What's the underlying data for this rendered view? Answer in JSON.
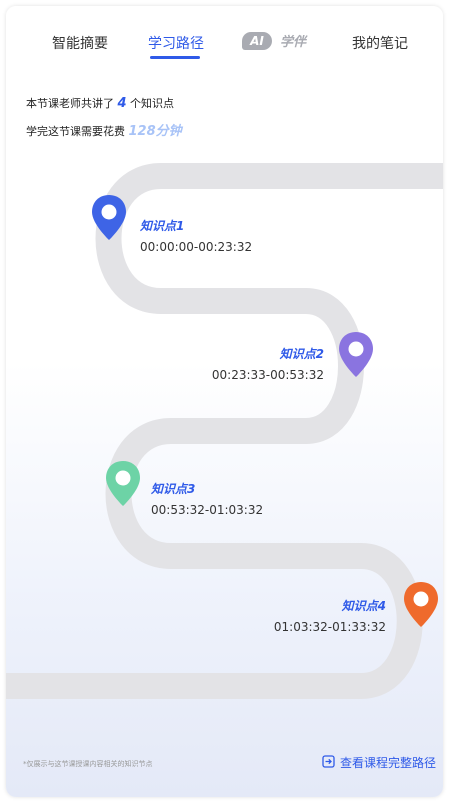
{
  "tabs": [
    {
      "label": "智能摘要",
      "active": false
    },
    {
      "label": "学习路径",
      "active": true
    },
    {
      "label": "学伴",
      "badge": "AI",
      "active": false
    },
    {
      "label": "我的笔记",
      "active": false
    }
  ],
  "summary": {
    "line1_prefix": "本节课老师共讲了",
    "line1_count": "4",
    "line1_suffix": "个知识点",
    "line2_prefix": "学完这节课需要花费",
    "line2_duration": "128分钟"
  },
  "knowledge_points": [
    {
      "title": "知识点1",
      "time": "00:00:00-00:23:32",
      "color": "#3e64e6"
    },
    {
      "title": "知识点2",
      "time": "00:23:33-00:53:32",
      "color": "#8a74e0"
    },
    {
      "title": "知识点3",
      "time": "00:53:32-01:03:32",
      "color": "#6dd3a6"
    },
    {
      "title": "知识点4",
      "time": "01:03:32-01:33:32",
      "color": "#ef6a2c"
    }
  ],
  "footer": {
    "note": "*仅展示与这节课授课内容相关的知识节点",
    "full_path_label": "查看课程完整路径"
  },
  "colors": {
    "accent": "#2f5ae8",
    "road": "#e3e3e6"
  }
}
